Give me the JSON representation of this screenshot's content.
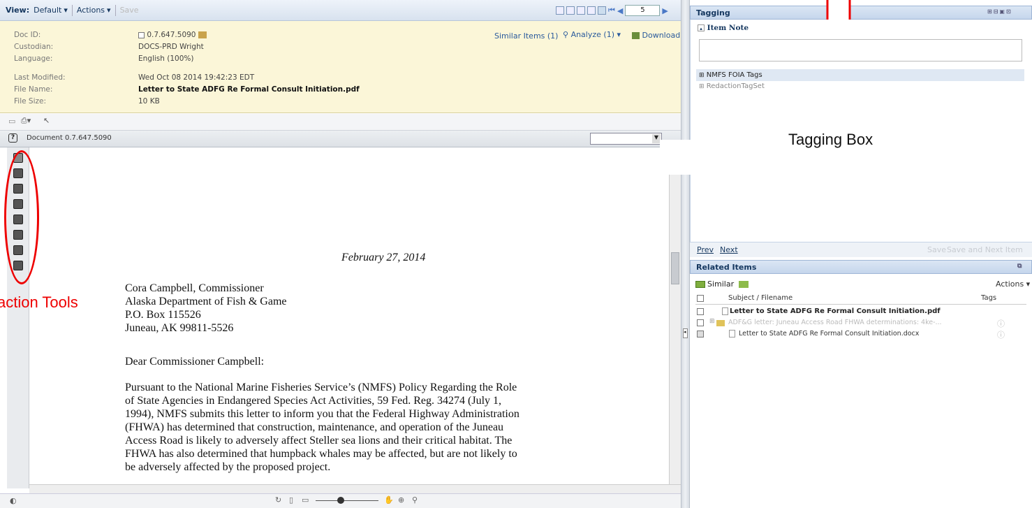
{
  "toolbar": {
    "view_label": "View:",
    "view_value": "Default",
    "actions_label": "Actions",
    "save_label": "Save",
    "page_number": "5"
  },
  "meta": {
    "labels": {
      "doc_id": "Doc ID:",
      "custodian": "Custodian:",
      "language": "Language:",
      "last_modified": "Last Modified:",
      "file_name": "File Name:",
      "file_size": "File Size:"
    },
    "doc_id": "0.7.647.5090",
    "custodian": "DOCS-PRD Wright",
    "language": "English (100%)",
    "last_modified": "Wed Oct 08 2014 19:42:23 EDT",
    "file_name": "Letter to State ADFG Re Formal Consult Initiation.pdf",
    "file_size": "10 KB",
    "similar": "Similar Items (1)",
    "analyze": "Analyze (1)",
    "download": "Download"
  },
  "viewer": {
    "doc_label": "Document 0.7.647.5090"
  },
  "annotations": {
    "redaction": "action Tools",
    "tagging": "Tagging Box"
  },
  "letter": {
    "date": "February 27, 2014",
    "addr1": "Cora Campbell, Commissioner",
    "addr2": "Alaska Department of Fish & Game",
    "addr3": "P.O. Box 115526",
    "addr4": "Juneau, AK 99811-5526",
    "salutation": "Dear Commissioner Campbell:",
    "body_lines": [
      "Pursuant to the National Marine Fisheries Service’s (NMFS) Policy Regarding the Role",
      "of State Agencies in Endangered Species Act Activities, 59 Fed. Reg. 34274 (July 1,",
      "1994), NMFS submits this letter to inform you that the Federal Highway Administration",
      "(FHWA) has determined that construction, maintenance, and operation of the Juneau",
      "Access Road is likely to adversely affect Steller sea lions and their critical habitat. The",
      "FHWA has also determined that humpback whales may be affected, but are not likely to",
      "be adversely affected by the proposed project."
    ]
  },
  "tagging": {
    "title": "Tagging",
    "item_note": "Item Note",
    "tag1": "NMFS FOIA Tags",
    "tag2": "RedactionTagSet",
    "prev": "Prev",
    "next": "Next",
    "save": "Save",
    "save_next": "Save and Next Item"
  },
  "related": {
    "title": "Related Items",
    "similar": "Similar",
    "actions": "Actions",
    "col_subject": "Subject / Filename",
    "col_tags": "Tags",
    "rows": [
      "Letter to State ADFG Re Formal Consult Initiation.pdf",
      "ADF&G letter: Juneau Access Road FHWA determinations: 4ke-...",
      "Letter to State ADFG Re Formal Consult Initiation.docx"
    ]
  },
  "colors": {
    "accent": "#15375f",
    "annotation": "#e00000",
    "meta_bg": "#fbf6d8"
  }
}
